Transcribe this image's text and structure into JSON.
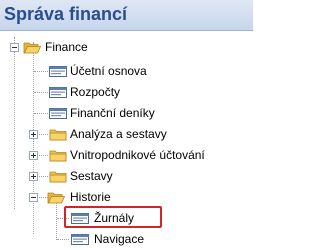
{
  "panel": {
    "title": "Správa financí"
  },
  "tree": {
    "root": {
      "label": "Finance"
    },
    "items": [
      {
        "label": "Účetní osnova"
      },
      {
        "label": "Rozpočty"
      },
      {
        "label": "Finanční deníky"
      },
      {
        "label": "Analýza a sestavy"
      },
      {
        "label": "Vnitropodnikové účtování"
      },
      {
        "label": "Sestavy"
      },
      {
        "label": "Historie"
      },
      {
        "label": "Žurnály"
      },
      {
        "label": "Navigace"
      }
    ]
  },
  "colors": {
    "title": "#2a4d8f",
    "highlight": "#d0262a",
    "folder": "#f3c24d"
  }
}
